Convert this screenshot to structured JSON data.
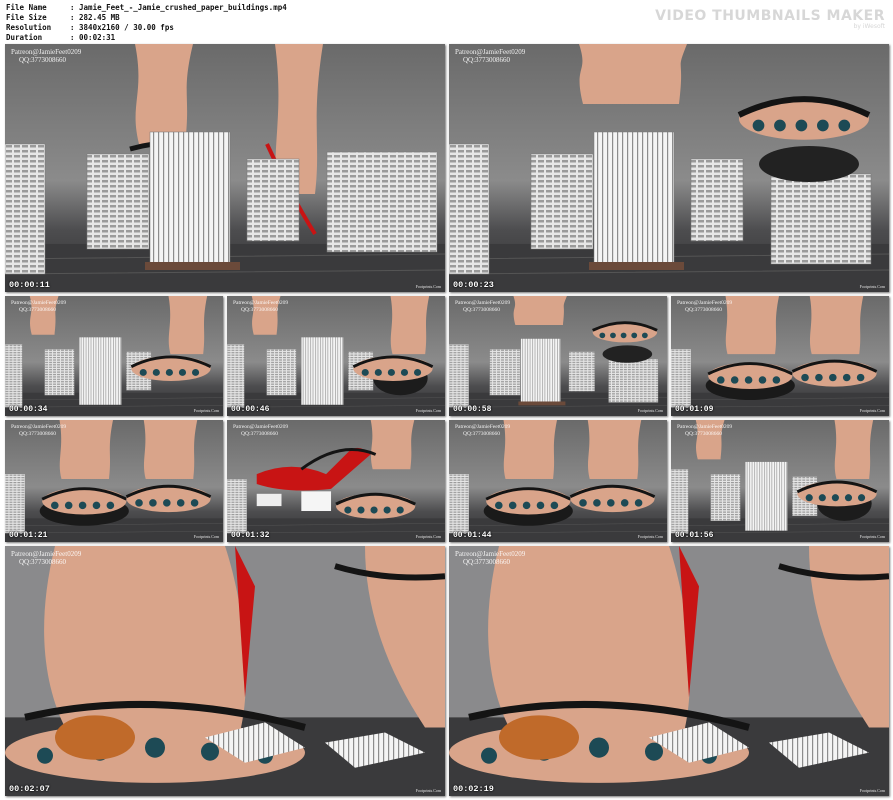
{
  "header": {
    "file_name_label": "File Name",
    "file_name": ": Jamie_Feet_-_Jamie_crushed_paper_buildings.mp4",
    "file_size_label": "File Size",
    "file_size": ": 282.45 MB",
    "resolution_label": "Resolution",
    "resolution": ": 3840x2160 / 30.00 fps",
    "duration_label": "Duration",
    "duration": ": 00:02:31"
  },
  "watermark": {
    "title": "VIDEO THUMBNAILS MAKER",
    "subtitle": "by iWesoft"
  },
  "overlay": {
    "line1": "Patreon@JamieFeet0209",
    "line2": "QQ:3773008660",
    "brand": "Footprints.Com"
  },
  "thumbnails": [
    {
      "timestamp": "00:00:11",
      "scene": "buildings"
    },
    {
      "timestamp": "00:00:23",
      "scene": "foot-top"
    },
    {
      "timestamp": "00:00:34",
      "scene": "foot-right"
    },
    {
      "timestamp": "00:00:46",
      "scene": "foot-right-crush"
    },
    {
      "timestamp": "00:00:58",
      "scene": "foot-top"
    },
    {
      "timestamp": "00:01:09",
      "scene": "feet-close"
    },
    {
      "timestamp": "00:01:21",
      "scene": "feet-close"
    },
    {
      "timestamp": "00:01:32",
      "scene": "heel-up"
    },
    {
      "timestamp": "00:01:44",
      "scene": "feet-close"
    },
    {
      "timestamp": "00:01:56",
      "scene": "foot-right-crush"
    },
    {
      "timestamp": "00:02:07",
      "scene": "closeup"
    },
    {
      "timestamp": "00:02:19",
      "scene": "closeup"
    }
  ],
  "colors": {
    "skin": "#d9a48a",
    "heel": "#c81414",
    "strap": "#141414",
    "building": "#e6e6e6",
    "floor": "#3a3a3c"
  }
}
